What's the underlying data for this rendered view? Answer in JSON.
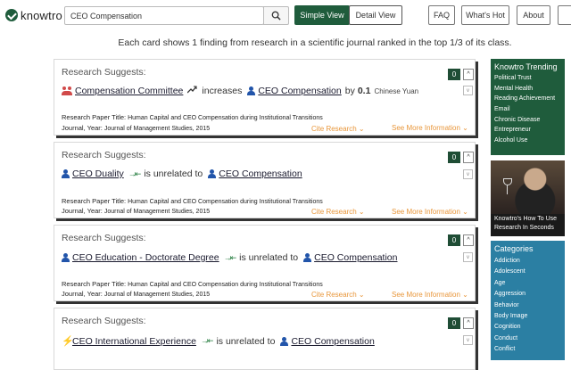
{
  "header": {
    "logo_text": "knowtro",
    "search_value": "CEO Compensation",
    "simple_view": "Simple View",
    "detail_view": "Detail View",
    "nav": {
      "faq": "FAQ",
      "hot": "What's Hot",
      "about": "About"
    }
  },
  "tagline": "Each card shows 1 finding from research in a scientific journal ranked in the top 1/3 of its class.",
  "cards": [
    {
      "head": "Research Suggests:",
      "votes": "0",
      "up": "^",
      "down": "v",
      "subject": "Compensation Committee",
      "relation": "increases",
      "object": "CEO Compensation",
      "by": "by",
      "amount": "0.1",
      "currency": "Chinese Yuan",
      "title_label": "Research Paper Title:",
      "title": "Human Capital and CEO Compensation during Institutional Transitions",
      "journal_label": "Journal, Year:",
      "journal": "Journal of Management Studies, 2015",
      "cite": "Cite Research ⌄",
      "more": "See More Information ⌄"
    },
    {
      "head": "Research Suggests:",
      "votes": "0",
      "up": "^",
      "down": "v",
      "subject": "CEO Duality",
      "relation": "is unrelated to",
      "object": "CEO Compensation",
      "title_label": "Research Paper Title:",
      "title": "Human Capital and CEO Compensation during Institutional Transitions",
      "journal_label": "Journal, Year:",
      "journal": "Journal of Management Studies, 2015",
      "cite": "Cite Research ⌄",
      "more": "See More Information ⌄"
    },
    {
      "head": "Research Suggests:",
      "votes": "0",
      "up": "^",
      "down": "v",
      "subject": "CEO Education - Doctorate Degree",
      "relation": "is unrelated to",
      "object": "CEO Compensation",
      "title_label": "Research Paper Title:",
      "title": "Human Capital and CEO Compensation during Institutional Transitions",
      "journal_label": "Journal, Year:",
      "journal": "Journal of Management Studies, 2015",
      "cite": "Cite Research ⌄",
      "more": "See More Information ⌄"
    },
    {
      "head": "Research Suggests:",
      "votes": "0",
      "up": "^",
      "down": "v",
      "subject": "CEO International Experience",
      "relation": "is unrelated to",
      "object": "CEO Compensation"
    }
  ],
  "trending": {
    "title": "Knowtro Trending",
    "items": [
      "Political Trust",
      "Mental Health",
      "Reading Achievement",
      "Email",
      "Chronic Disease",
      "Entrepreneur",
      "Alcohol Use"
    ]
  },
  "howto": {
    "line1": "Knowtro's How To Use",
    "line2": "Research In Seconds"
  },
  "categories": {
    "title": "Categories",
    "items": [
      "Addiction",
      "Adolescent",
      "Age",
      "Aggression",
      "Behavior",
      "Body Image",
      "Cognition",
      "Conduct",
      "Conflict"
    ]
  },
  "colors": {
    "brand_green": "#1f5c3c",
    "category_blue": "#2b7fa3",
    "accent_orange": "#e8963a"
  }
}
